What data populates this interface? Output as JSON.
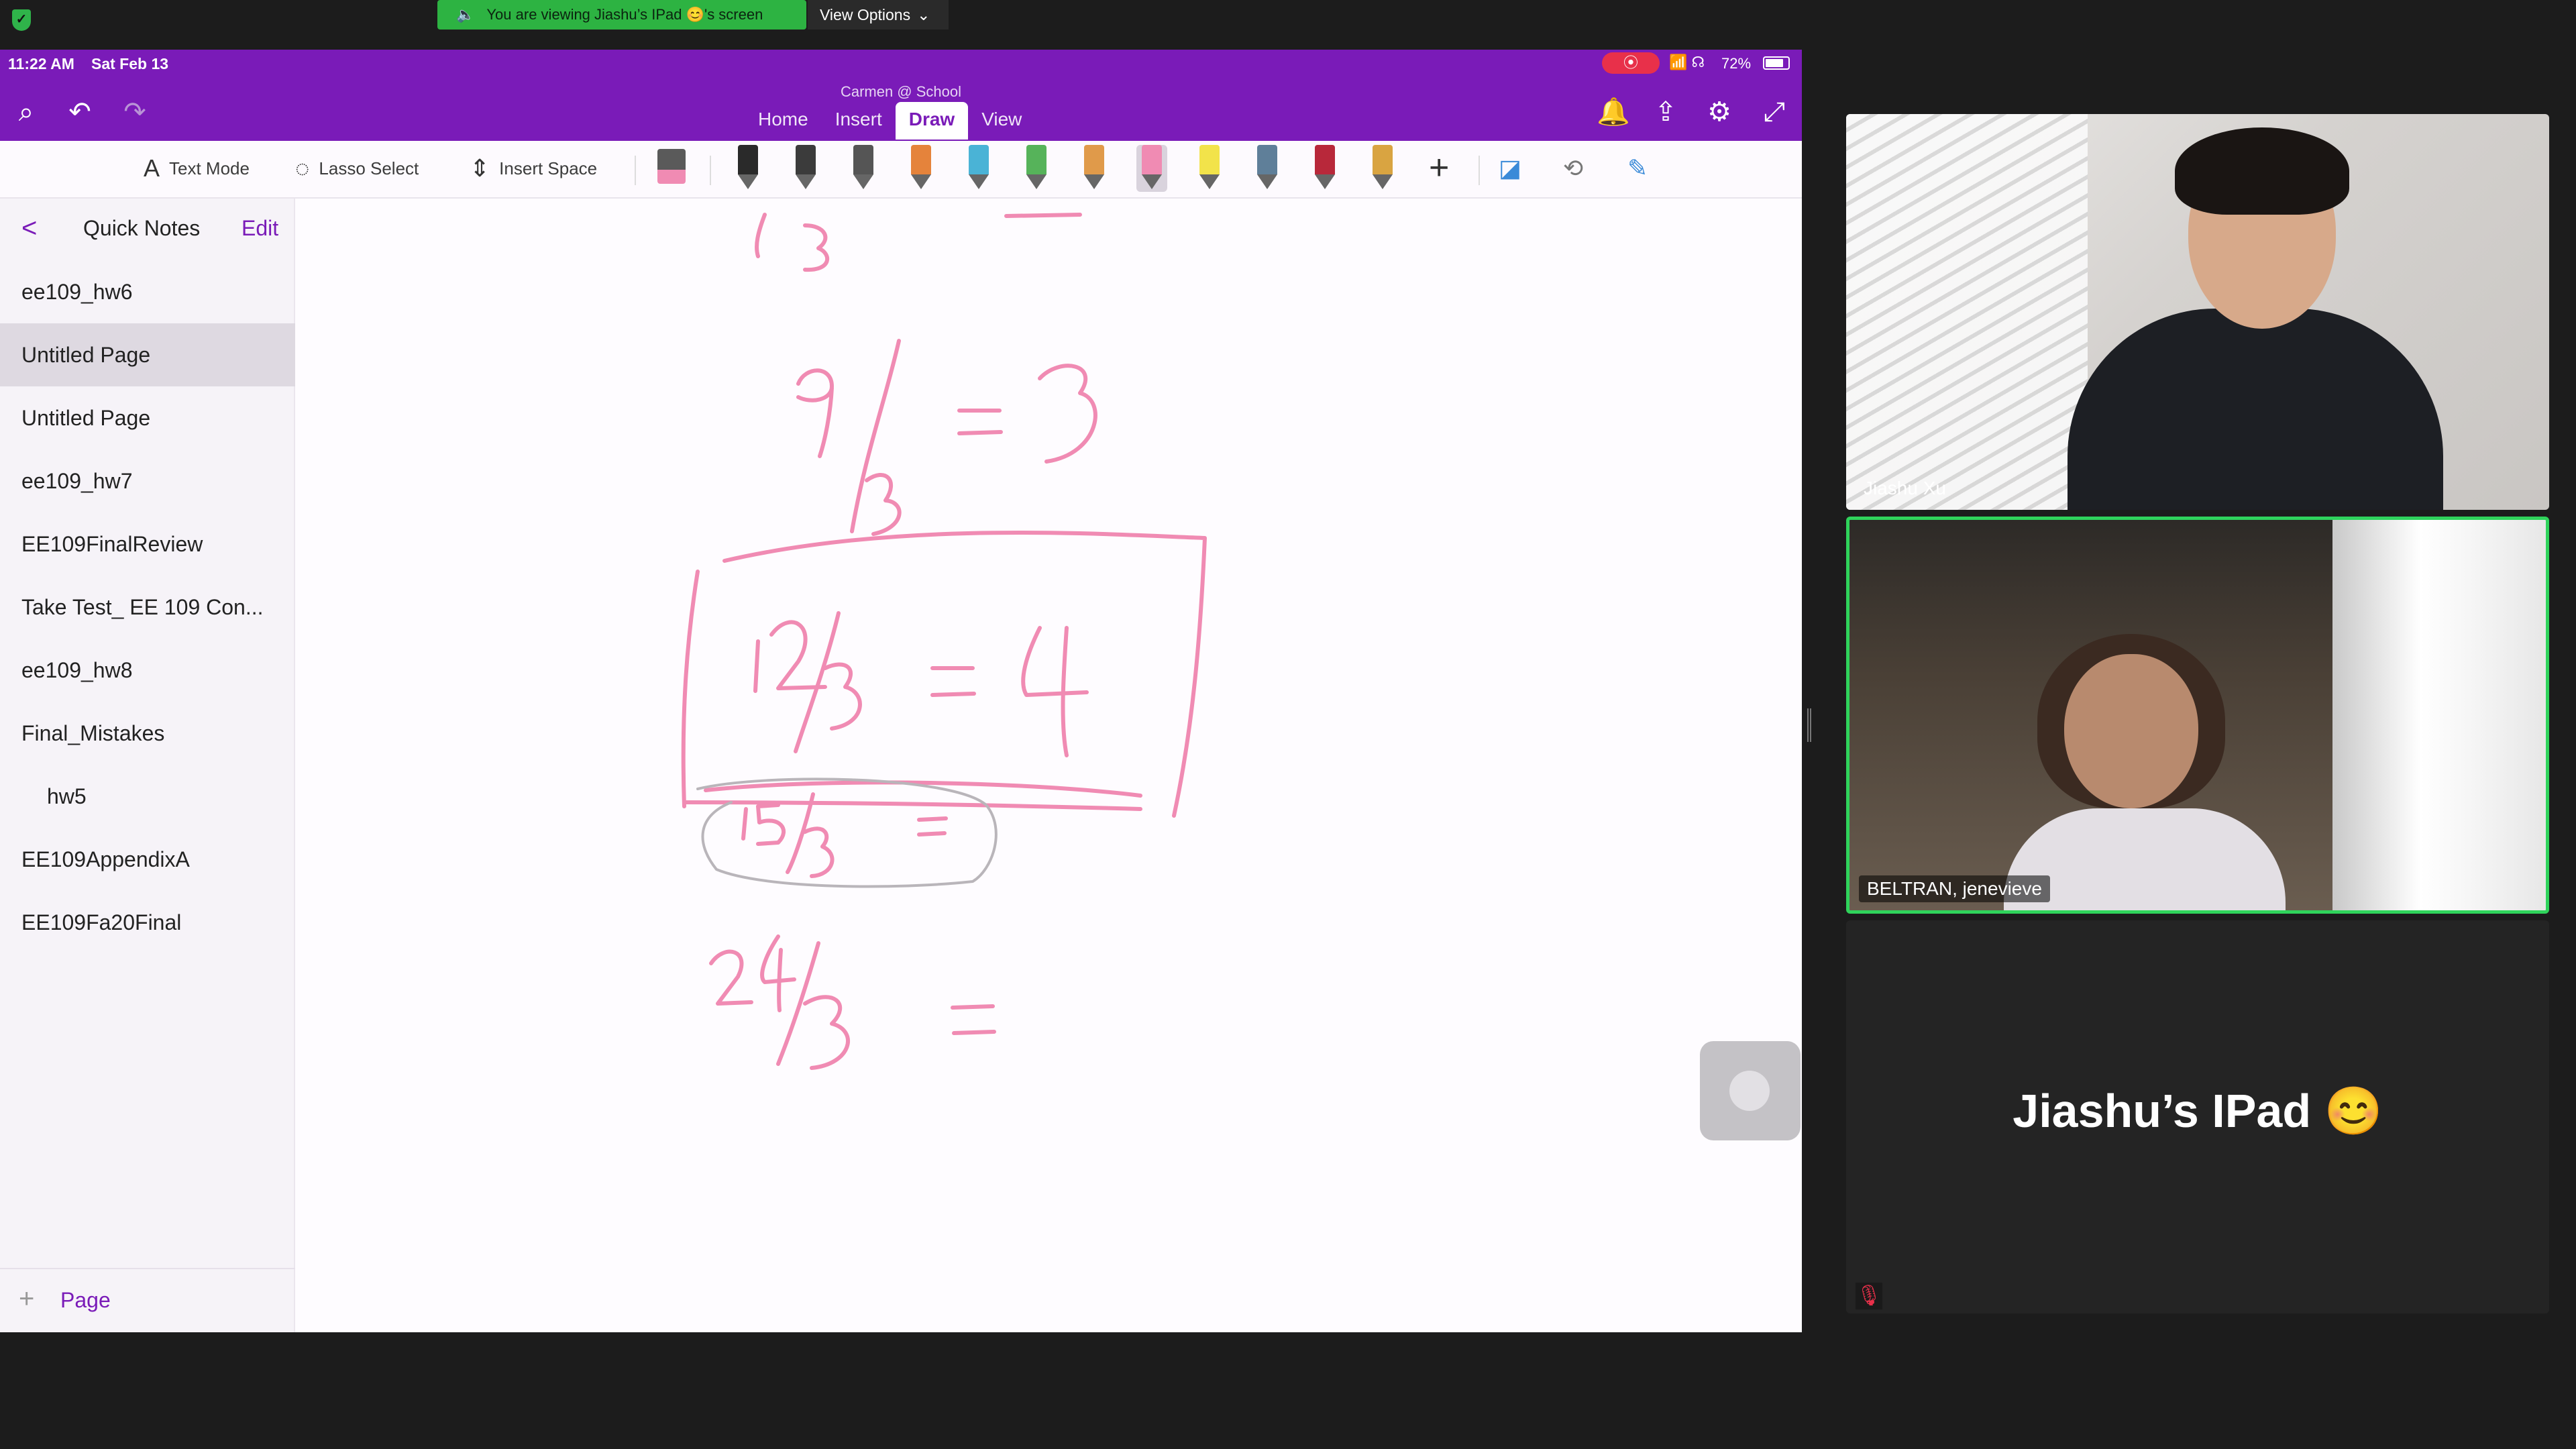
{
  "zoom": {
    "banner_text": "You are viewing Jiashu’s IPad 😊's screen",
    "view_options": "View Options"
  },
  "ipad": {
    "status": {
      "time": "11:22 AM",
      "date": "Sat Feb 13",
      "battery": "72%"
    },
    "notebook_title": "Carmen @ School",
    "tabs": [
      "Home",
      "Insert",
      "Draw",
      "View"
    ],
    "active_tab": "Draw",
    "toolbar": {
      "text_mode": "Text Mode",
      "lasso_select": "Lasso Select",
      "insert_space": "Insert Space"
    },
    "pens": [
      {
        "color": "#2a2a2a"
      },
      {
        "color": "#3b3b3b"
      },
      {
        "color": "#555555"
      },
      {
        "color": "#e5833b"
      },
      {
        "color": "#4ab3d6"
      },
      {
        "color": "#56b35a"
      },
      {
        "color": "#e09a4a"
      },
      {
        "color": "#f08bb3",
        "selected": true
      },
      {
        "color": "#f2e34a"
      },
      {
        "color": "#5f7f99"
      },
      {
        "color": "#b8283a"
      },
      {
        "color": "#d9a441"
      }
    ],
    "sidebar": {
      "back": "<",
      "title": "Quick Notes",
      "edit": "Edit",
      "items": [
        {
          "label": "ee109_hw6"
        },
        {
          "label": "Untitled Page",
          "active": true
        },
        {
          "label": "Untitled Page"
        },
        {
          "label": "ee109_hw7"
        },
        {
          "label": "EE109FinalReview"
        },
        {
          "label": "Take Test_ EE 109 Con..."
        },
        {
          "label": "ee109_hw8"
        },
        {
          "label": "Final_Mistakes"
        },
        {
          "label": "hw5",
          "sub": true
        },
        {
          "label": "EE109AppendixA"
        },
        {
          "label": "EE109Fa20Final"
        }
      ],
      "add_page": "Page"
    },
    "ink_color": "#f08bb3"
  },
  "participants": [
    {
      "name": "Jiashu Xu"
    },
    {
      "name": "BELTRAN, jenevieve",
      "active_speaker": true
    },
    {
      "name": "Jiashu’s IPad 😊",
      "screen_share": true,
      "muted": true
    }
  ]
}
